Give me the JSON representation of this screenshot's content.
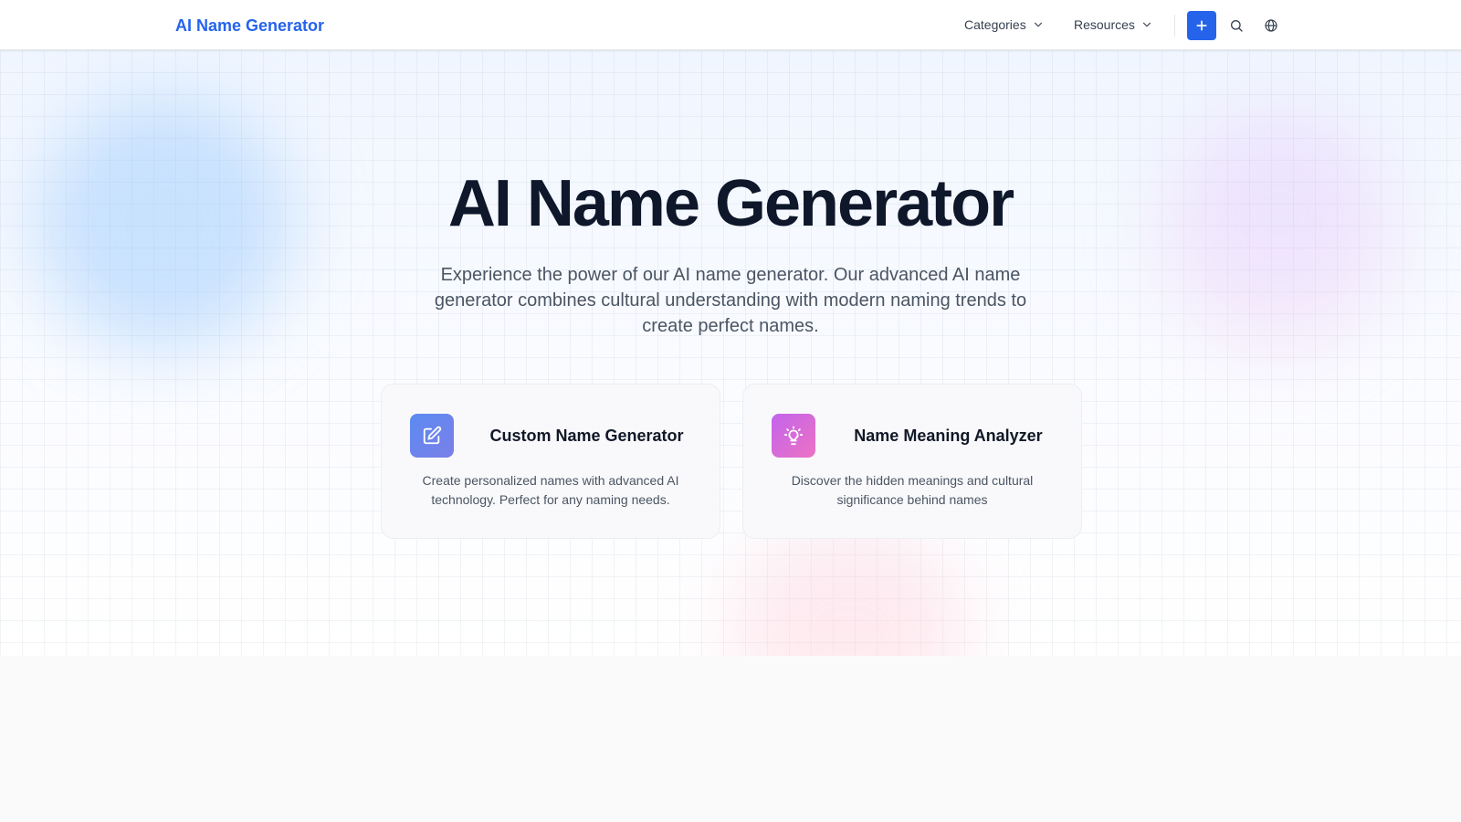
{
  "header": {
    "logo": "AI Name Generator",
    "nav": [
      {
        "label": "Categories",
        "icon": "chevron-down-icon"
      },
      {
        "label": "Resources",
        "icon": "chevron-down-icon"
      }
    ],
    "actions": {
      "add_icon": "plus-icon",
      "search_icon": "search-icon",
      "language_icon": "globe-icon"
    }
  },
  "hero": {
    "title": "AI Name Generator",
    "subtitle": "Experience the power of our AI name generator. Our advanced AI name generator combines cultural understanding with modern naming trends to create perfect names."
  },
  "cards": [
    {
      "title": "Custom Name Generator",
      "description": "Create personalized names with advanced AI technology. Perfect for any naming needs.",
      "icon": "edit-icon",
      "color": "#6b87f0"
    },
    {
      "title": "Name Meaning Analyzer",
      "description": "Discover the hidden meanings and cultural significance behind names",
      "icon": "lightbulb-icon",
      "color": "#d86bdc"
    }
  ],
  "colors": {
    "brand": "#2563eb",
    "title": "#0f172a",
    "text": "#4b5563"
  }
}
